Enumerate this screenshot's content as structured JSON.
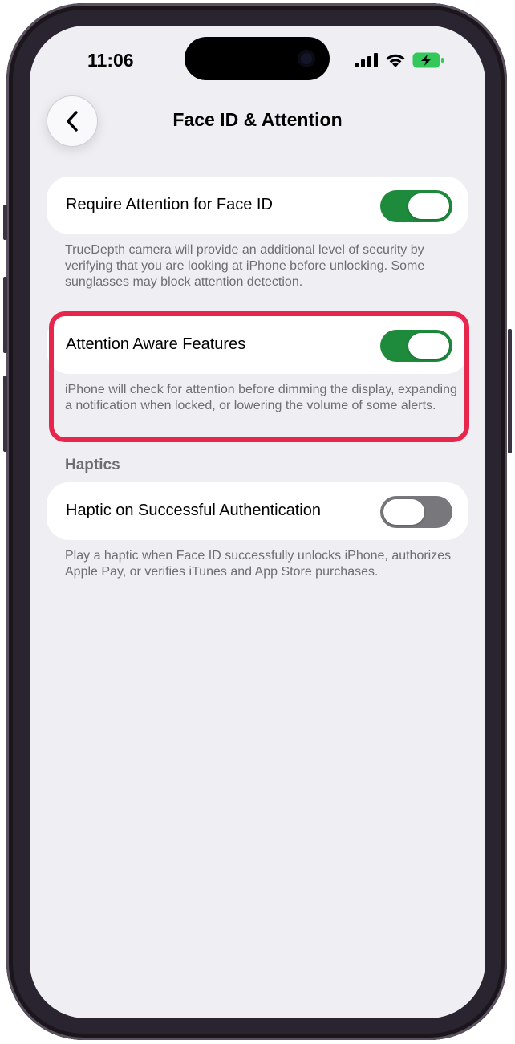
{
  "status_bar": {
    "time": "11:06",
    "icons": [
      "cellular-signal-icon",
      "wifi-icon",
      "battery-charging-icon"
    ]
  },
  "nav": {
    "back_icon": "chevron-left-icon",
    "title": "Face ID & Attention"
  },
  "settings": {
    "require_attention": {
      "label": "Require Attention for Face ID",
      "enabled": true,
      "footnote": "TrueDepth camera will provide an additional level of security by verifying that you are looking at iPhone before unlocking. Some sunglasses may block attention detection."
    },
    "attention_aware": {
      "label": "Attention Aware Features",
      "enabled": true,
      "footnote": "iPhone will check for attention before dimming the display, expanding a notification when locked, or lowering the volume of some alerts."
    },
    "haptics": {
      "section_header": "Haptics",
      "label": "Haptic on Successful Authentication",
      "enabled": false,
      "footnote": "Play a haptic when Face ID successfully unlocks iPhone, authorizes Apple Pay, or verifies iTunes and App Store purchases."
    }
  },
  "colors": {
    "toggle_on": "#1e8a3c",
    "toggle_off": "#78787c",
    "highlight": "#e8254a",
    "background": "#efeef3"
  }
}
